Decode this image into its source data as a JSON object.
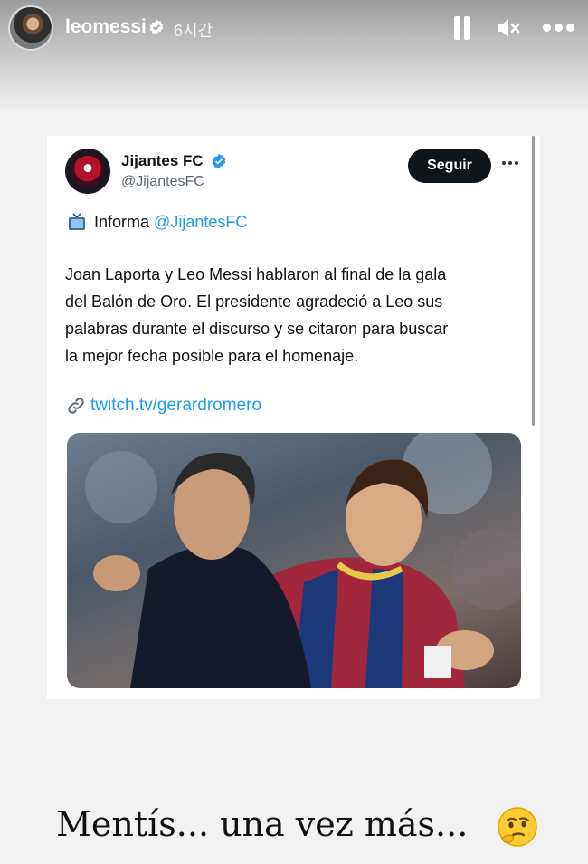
{
  "story": {
    "username": "leomessi",
    "time": "6시간",
    "caption": "Mentís... una vez más...",
    "caption_emoji": "thinking-face-icon"
  },
  "tweet": {
    "name": "Jijantes FC",
    "handle": "@JijantesFC",
    "follow_label": "Seguir",
    "informa_label": "Informa",
    "informa_mention": "@JijantesFC",
    "body": "Joan Laporta y Leo Messi hablaron al final de la gala\ndel Balón de Oro. El presidente agradeció a Leo sus\npalabras  durante el discurso y se citaron para buscar\nla mejor fecha posible para el homenaje.",
    "link": "twitch.tv/gerardromero"
  },
  "colors": {
    "accent": "#1d9bf0",
    "follow_bg": "#0f1419"
  }
}
